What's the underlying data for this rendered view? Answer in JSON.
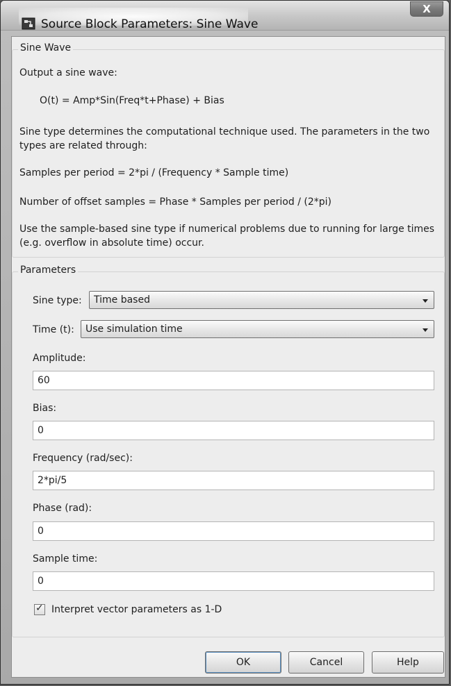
{
  "window": {
    "title": "Source Block Parameters: Sine Wave",
    "close_glyph": "X"
  },
  "description_group": {
    "legend": "Sine Wave",
    "lines": [
      "Output a sine wave:",
      "O(t) = Amp*Sin(Freq*t+Phase) + Bias",
      "Sine type determines the computational technique used. The parameters in the two types are related through:",
      "Samples per period = 2*pi / (Frequency * Sample time)",
      "Number of offset samples = Phase * Samples per period / (2*pi)",
      "Use the sample-based sine type if numerical problems due to running for large times (e.g. overflow in absolute time) occur."
    ]
  },
  "parameters_group": {
    "legend": "Parameters",
    "sine_type": {
      "label": "Sine type:",
      "value": "Time based"
    },
    "time": {
      "label": "Time (t):",
      "value": "Use simulation time"
    },
    "amplitude": {
      "label": "Amplitude:",
      "value": "60"
    },
    "bias": {
      "label": "Bias:",
      "value": "0"
    },
    "frequency": {
      "label": "Frequency (rad/sec):",
      "value": "2*pi/5"
    },
    "phase": {
      "label": "Phase (rad):",
      "value": "0"
    },
    "sample_time": {
      "label": "Sample time:",
      "value": "0"
    },
    "interpret_vector": {
      "label": "Interpret vector parameters as 1-D",
      "checked": true,
      "glyph": "✓"
    }
  },
  "buttons": {
    "ok": "OK",
    "cancel": "Cancel",
    "help": "Help"
  },
  "icons": {
    "app": "simulink-block-icon",
    "close": "close-icon",
    "dropdown": "chevron-down-icon",
    "check": "checkmark-icon"
  }
}
